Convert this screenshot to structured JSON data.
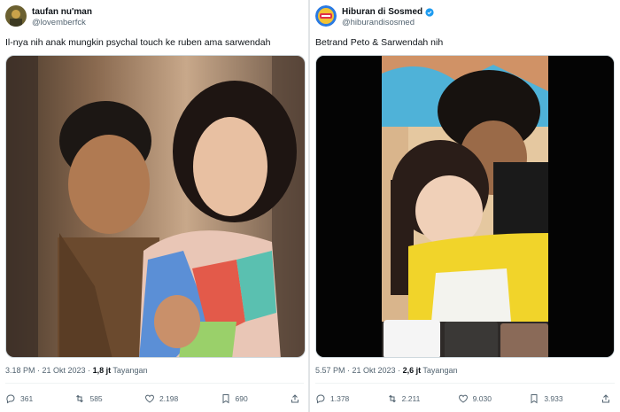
{
  "left": {
    "display_name": "taufan nu'man",
    "handle": "@lovemberfck",
    "text": "Il-nya nih anak mungkin psychal touch ke ruben ama sarwendah",
    "time": "3.18 PM · 21 Okt 2023 ·",
    "views": "1,8 jt",
    "views_label": "Tayangan",
    "replies": "361",
    "retweets": "585",
    "likes": "2.198",
    "bookmarks": "690"
  },
  "right": {
    "display_name": "Hiburan di Sosmed",
    "handle": "@hiburandisosmed",
    "text": "Betrand Peto & Sarwendah nih",
    "time": "5.57 PM · 21 Okt 2023 ·",
    "views": "2,6 jt",
    "views_label": "Tayangan",
    "replies": "1.378",
    "retweets": "2.211",
    "likes": "9.030",
    "bookmarks": "3.933"
  },
  "colors": {
    "verified": "#1d9bf0",
    "muted": "#536471",
    "text": "#0f1419"
  },
  "icons": [
    "reply-icon",
    "retweet-icon",
    "like-icon",
    "bookmark-icon",
    "share-icon",
    "verified-badge-icon"
  ]
}
